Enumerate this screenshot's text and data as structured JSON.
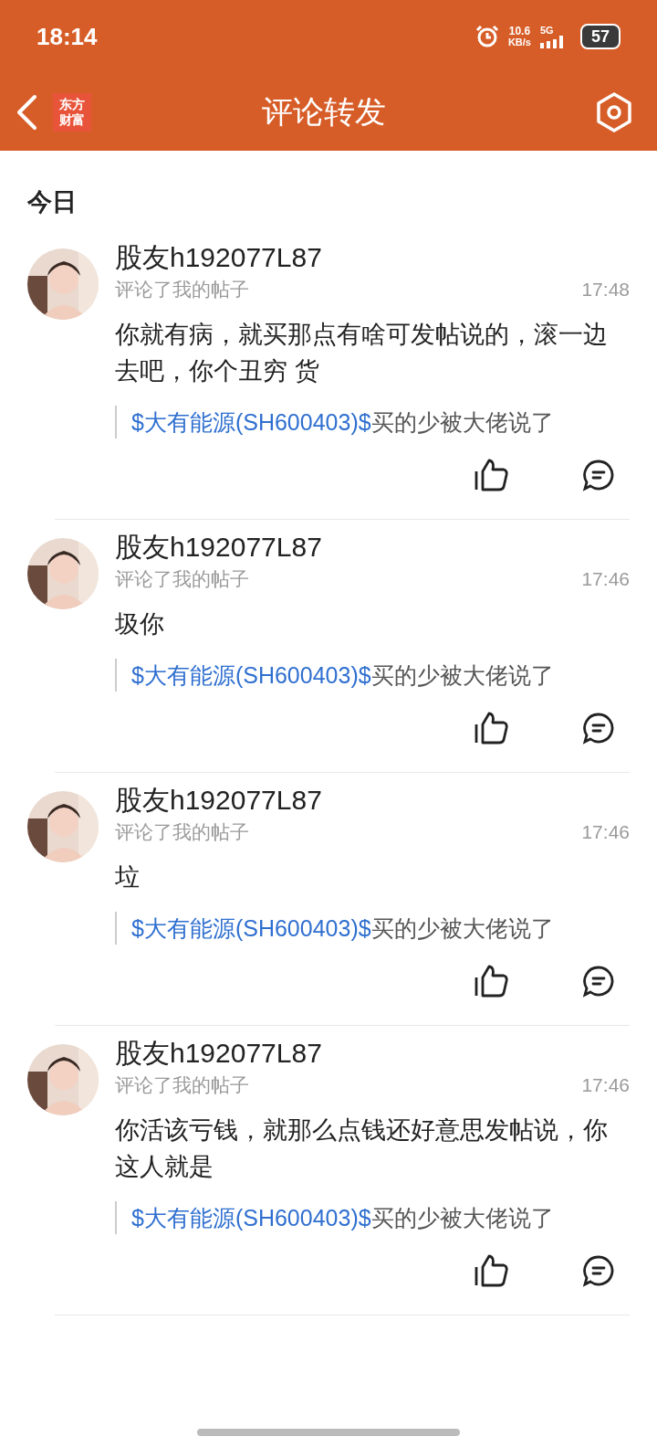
{
  "status_bar": {
    "time": "18:14",
    "net_speed": "10.6",
    "net_unit": "KB/s",
    "network": "5G",
    "battery": "57"
  },
  "header": {
    "logo_top": "东方",
    "logo_bottom": "财富",
    "title": "评论转发"
  },
  "section": "今日",
  "comments": [
    {
      "user": "股友h192077L87",
      "action": "评论了我的帖子",
      "time": "17:48",
      "text": "你就有病，就买那点有啥可发帖说的，滚一边去吧，你个丑穷 货",
      "quote_link": "$大有能源(SH600403)$",
      "quote_text": "买的少被大佬说了"
    },
    {
      "user": "股友h192077L87",
      "action": "评论了我的帖子",
      "time": "17:46",
      "text": "圾你",
      "quote_link": "$大有能源(SH600403)$",
      "quote_text": "买的少被大佬说了"
    },
    {
      "user": "股友h192077L87",
      "action": "评论了我的帖子",
      "time": "17:46",
      "text": "垃",
      "quote_link": "$大有能源(SH600403)$",
      "quote_text": "买的少被大佬说了"
    },
    {
      "user": "股友h192077L87",
      "action": "评论了我的帖子",
      "time": "17:46",
      "text": "你活该亏钱，就那么点钱还好意思发帖说，你这人就是",
      "quote_link": "$大有能源(SH600403)$",
      "quote_text": "买的少被大佬说了"
    }
  ]
}
